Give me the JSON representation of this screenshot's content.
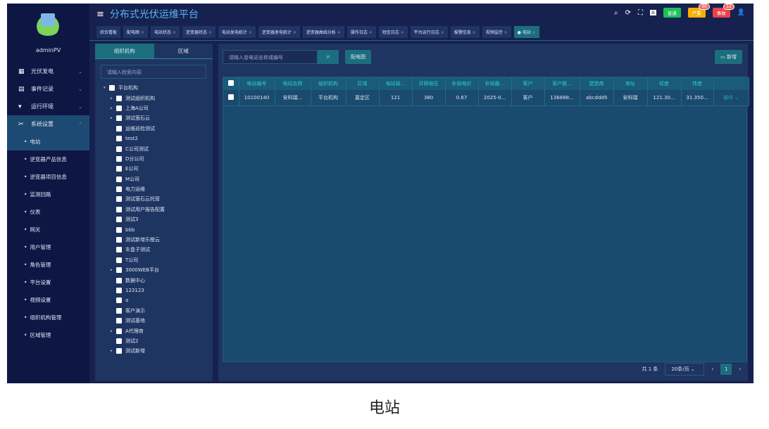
{
  "app": {
    "title": "分布式光伏运维平台",
    "user": "adminPV"
  },
  "header": {
    "badges": [
      {
        "label": "普通",
        "color": "#1fbf5a",
        "count": ""
      },
      {
        "label": "严重",
        "color": "#f5b000",
        "count": "96"
      },
      {
        "label": "事故",
        "color": "#e8414b",
        "count": "12"
      }
    ]
  },
  "sidebar": {
    "items": [
      {
        "label": "光伏发电",
        "icon": "solar-panel-icon"
      },
      {
        "label": "事件记录",
        "icon": "record-icon"
      },
      {
        "label": "运行环境",
        "icon": "environment-icon"
      },
      {
        "label": "系统设置",
        "icon": "tools-icon"
      }
    ],
    "sub": [
      "电站",
      "逆变器产品信息",
      "逆变器项目信息",
      "监测回路",
      "仪表",
      "网关",
      "用户管理",
      "角色管理",
      "平台设置",
      "视频设置",
      "组织机构管理",
      "区域管理"
    ]
  },
  "tabs": [
    "综合看板",
    "配电图",
    "电站状态",
    "逆变器状态",
    "电站发电统计",
    "逆变器发电统计",
    "逆变器曲线分析",
    "操作日志",
    "短信日志",
    "平台运行日志",
    "报警信息",
    "视频监控",
    "电站"
  ],
  "left": {
    "tabs": [
      "组织机构",
      "区域"
    ],
    "search_placeholder": "请输入检索内容",
    "tree": [
      {
        "label": "平台机构",
        "level": 0,
        "exp": "▾"
      },
      {
        "label": "测试组织机构",
        "level": 1,
        "exp": "▸"
      },
      {
        "label": "上海A公司",
        "level": 1,
        "exp": "▸"
      },
      {
        "label": "测试萤石云",
        "level": 1,
        "exp": "▸"
      },
      {
        "label": "运维巡检测试",
        "level": 1,
        "exp": ""
      },
      {
        "label": "test2",
        "level": 1,
        "exp": ""
      },
      {
        "label": "C公司测试",
        "level": 1,
        "exp": ""
      },
      {
        "label": "D分公司",
        "level": 1,
        "exp": ""
      },
      {
        "label": "E公司",
        "level": 1,
        "exp": ""
      },
      {
        "label": "M公司",
        "level": 1,
        "exp": ""
      },
      {
        "label": "电力运维",
        "level": 1,
        "exp": ""
      },
      {
        "label": "测试萤石云托管",
        "level": 1,
        "exp": ""
      },
      {
        "label": "测试用户报告配置",
        "level": 1,
        "exp": ""
      },
      {
        "label": "测试3",
        "level": 1,
        "exp": ""
      },
      {
        "label": "bbb",
        "level": 1,
        "exp": ""
      },
      {
        "label": "测试新增乐橙云",
        "level": 1,
        "exp": ""
      },
      {
        "label": "车盒子测试",
        "level": 1,
        "exp": ""
      },
      {
        "label": "T公司",
        "level": 1,
        "exp": ""
      },
      {
        "label": "3000WEB平台",
        "level": 1,
        "exp": "▸"
      },
      {
        "label": "数据中心",
        "level": 1,
        "exp": ""
      },
      {
        "label": "123123",
        "level": 1,
        "exp": ""
      },
      {
        "label": "a",
        "level": 1,
        "exp": ""
      },
      {
        "label": "客户演示",
        "level": 1,
        "exp": ""
      },
      {
        "label": "测试基地",
        "level": 1,
        "exp": ""
      },
      {
        "label": "A代理商",
        "level": 1,
        "exp": "▸"
      },
      {
        "label": "测试2",
        "level": 1,
        "exp": ""
      },
      {
        "label": "测试新增",
        "level": 1,
        "exp": "▸"
      }
    ]
  },
  "main": {
    "search_placeholder": "请输入变电站名称或编号",
    "diagram_btn": "配电图",
    "add_btn": "新增",
    "columns": [
      "电站编号",
      "电站名称",
      "组织机构",
      "区域",
      "电站装...",
      "并网电压",
      "补贴电价",
      "补贴截...",
      "客户",
      "客户联...",
      "建造商",
      "地址",
      "经度",
      "纬度",
      ""
    ],
    "rows": [
      [
        "10100140",
        "安科瑞...",
        "平台机构",
        "嘉定区",
        "121",
        "380",
        "0.67",
        "2025-0...",
        "客户",
        "136888...",
        "abcddd9",
        "安科瑞",
        "121.30...",
        "31.350...",
        "操作 ⌄"
      ]
    ],
    "pager": {
      "total": "共 1 条",
      "size": "20条/页",
      "page": "1"
    }
  },
  "caption": "电站"
}
